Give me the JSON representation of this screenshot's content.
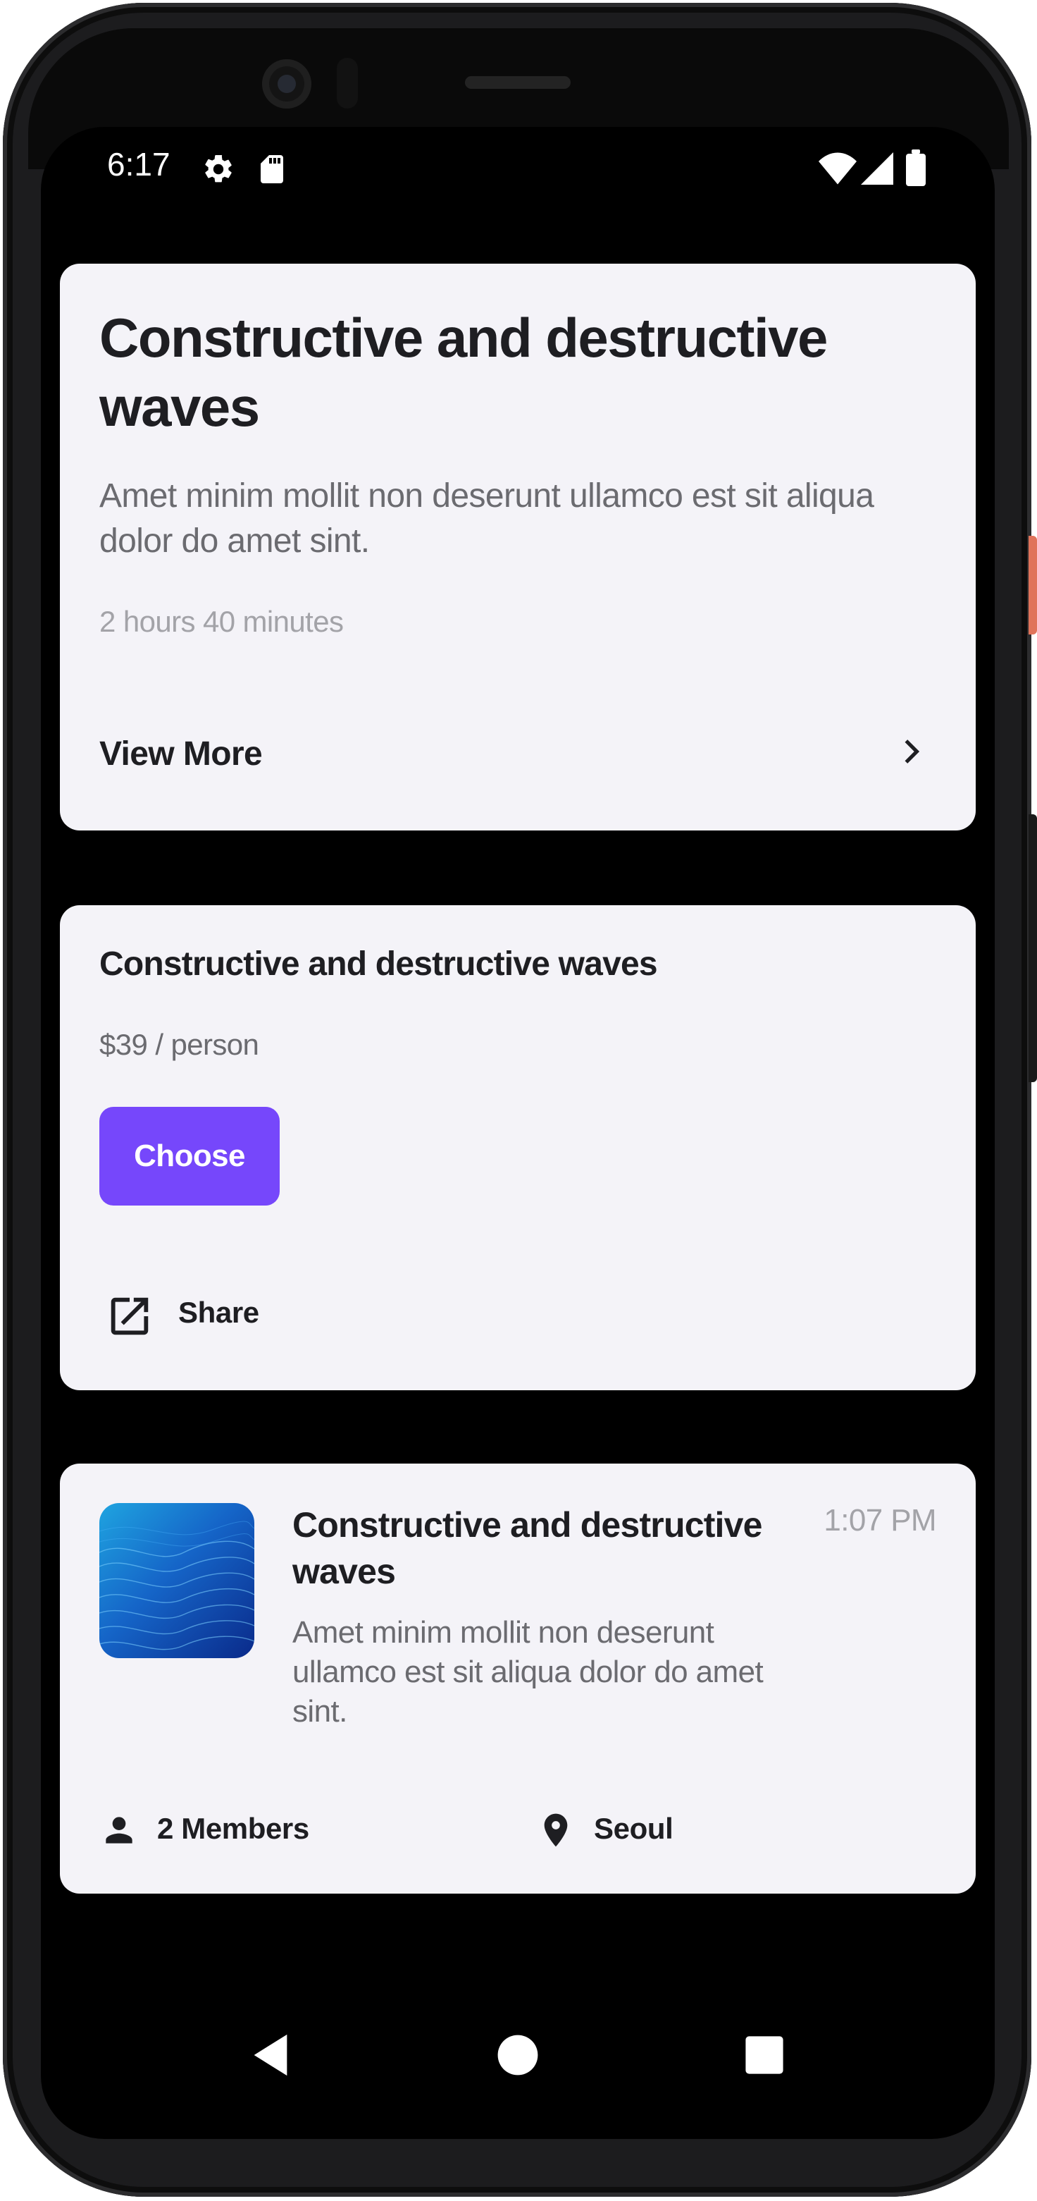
{
  "status_bar": {
    "time": "6:17",
    "icons": [
      "settings-icon",
      "sd-card-icon",
      "wifi-icon",
      "signal-icon",
      "battery-icon"
    ]
  },
  "card1": {
    "title": "Constructive and destructive waves",
    "description": "Amet minim mollit non deserunt ullamco est sit aliqua dolor do amet sint.",
    "duration": "2 hours 40 minutes",
    "view_more_label": "View More",
    "chevron_icon": "chevron-right-icon"
  },
  "card2": {
    "title": "Constructive and destructive waves",
    "price": "$39 / person",
    "choose_label": "Choose",
    "share_label": "Share",
    "share_icon": "open-in-new-icon",
    "accent_color": "#7647fb"
  },
  "card3": {
    "title": "Constructive and destructive waves",
    "time": "1:07 PM",
    "description": "Amet minim mollit non deserunt ullamco est sit aliqua dolor do amet sint.",
    "members_label": "2 Members",
    "location_label": "Seoul",
    "members_icon": "person-icon",
    "location_icon": "location-pin-icon"
  },
  "nav_bar": {
    "icons": [
      "back-icon",
      "home-icon",
      "recents-icon"
    ]
  },
  "colors": {
    "screen_background": "#000000",
    "card_background": "#f4f3f8",
    "primary_text": "#1e1e22",
    "secondary_text": "#6b6b70",
    "muted_text": "#a3a3a8",
    "accent": "#7647fb"
  }
}
